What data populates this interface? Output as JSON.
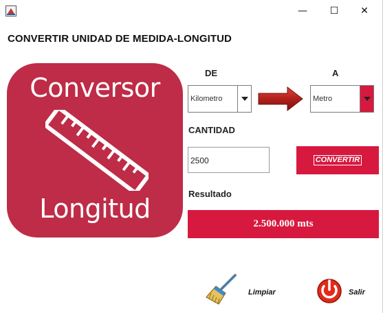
{
  "window": {
    "controls": {
      "minimize": "—",
      "maximize": "☐",
      "close": "✕"
    }
  },
  "heading": "CONVERTIR UNIDAD DE MEDIDA-LONGITUD",
  "logo": {
    "line1": "Conversor",
    "line2": "Longitud"
  },
  "from": {
    "label": "DE",
    "selected": "Kilometro"
  },
  "to": {
    "label": "A",
    "selected": "Metro"
  },
  "quantity": {
    "label": "CANTIDAD",
    "value": "2500"
  },
  "convert_button": "CONVERTIR",
  "result": {
    "label": "Resultado",
    "value": "2.500.000 mts"
  },
  "actions": {
    "clear": "Limpiar",
    "exit": "Salir"
  },
  "colors": {
    "accent": "#d7193f",
    "logo_bg": "#be2c47",
    "arrow": "#b3201b"
  },
  "icons": [
    "app-icon",
    "minimize-icon",
    "maximize-icon",
    "close-icon",
    "ruler-icon",
    "arrow-right-icon",
    "broom-icon",
    "power-icon"
  ]
}
